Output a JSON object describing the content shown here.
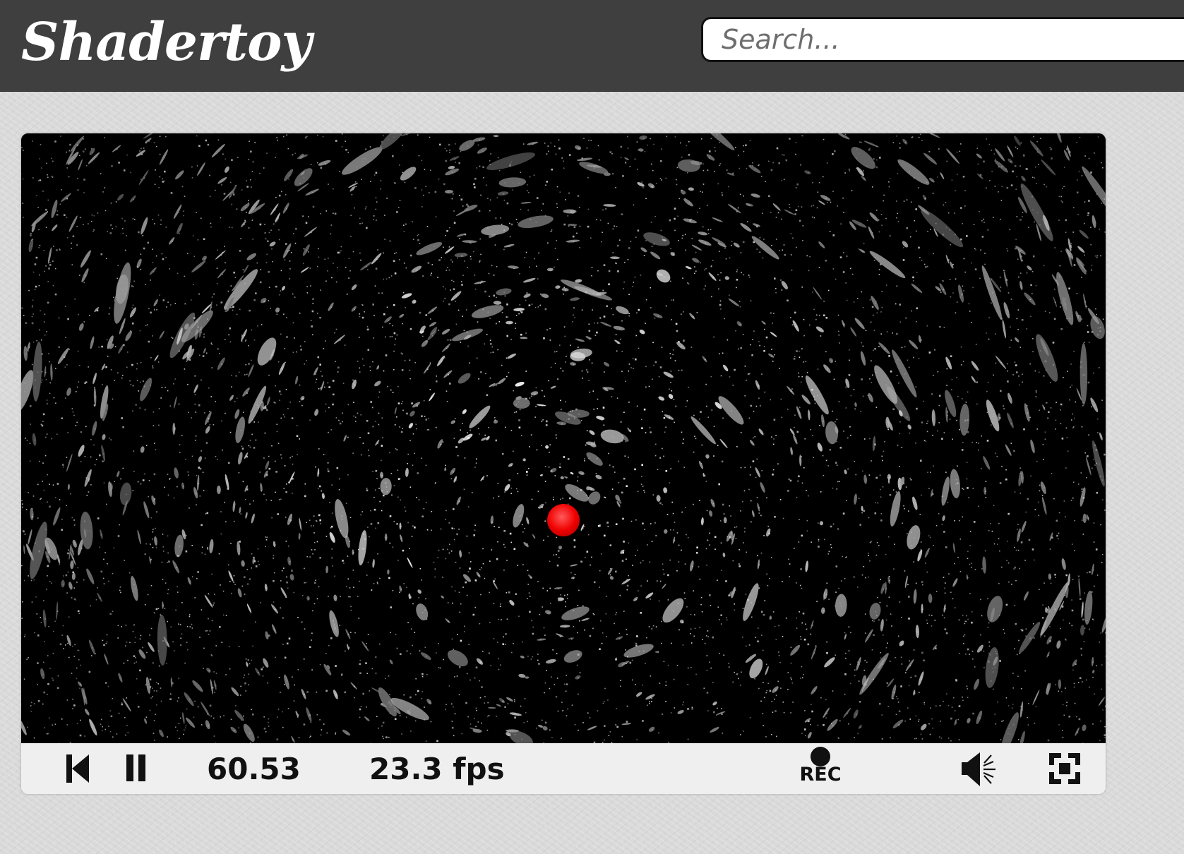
{
  "header": {
    "logo_text": "Shadertoy",
    "search": {
      "placeholder": "Search...",
      "value": ""
    }
  },
  "player": {
    "time": "60.53",
    "fps": "23.3 fps",
    "rec_label": "REC",
    "icons": {
      "rewind": "skip-to-start-icon",
      "pause": "pause-icon",
      "record": "record-icon",
      "volume": "volume-icon",
      "fullscreen": "fullscreen-icon"
    }
  },
  "colors": {
    "topbar": "#3f3f3f",
    "background": "#d9d9d9",
    "control_bar": "#efefef",
    "canvas": "#000000",
    "marker": "#ff0000"
  }
}
